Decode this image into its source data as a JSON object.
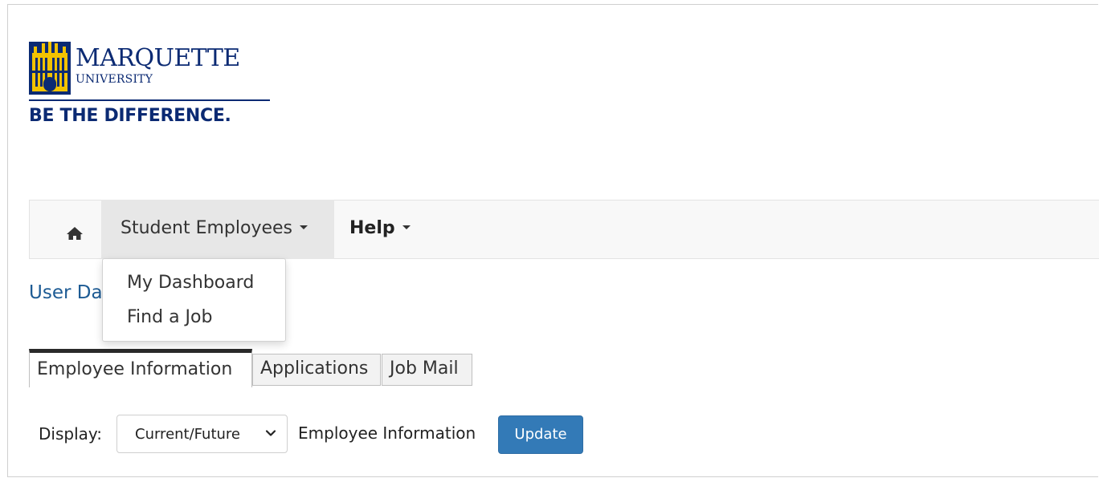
{
  "logo": {
    "name": "MARQUETTE",
    "subtitle": "UNIVERSITY",
    "tagline": "BE THE DIFFERENCE.",
    "colors": {
      "navy": "#0b2a73",
      "gold": "#f2c200"
    }
  },
  "navbar": {
    "home_icon": "home-icon",
    "menus": [
      {
        "label": "Student Employees",
        "open": true
      },
      {
        "label": "Help",
        "open": false
      }
    ]
  },
  "dropdown": {
    "items": [
      {
        "label": "My Dashboard"
      },
      {
        "label": "Find a Job"
      }
    ]
  },
  "page": {
    "heading_visible_fragment": "User Da"
  },
  "tabs": [
    {
      "label": "Employee Information",
      "active": true
    },
    {
      "label": "Applications",
      "active": false
    },
    {
      "label": "Job Mail",
      "active": false
    }
  ],
  "display": {
    "label": "Display:",
    "selected": "Current/Future",
    "caption": "Employee Information",
    "button": "Update"
  },
  "colors": {
    "accent_button": "#337ab7",
    "link": "#1d5b94",
    "navbar_bg": "#f8f8f8",
    "active_menu_bg": "#e7e7e7"
  }
}
